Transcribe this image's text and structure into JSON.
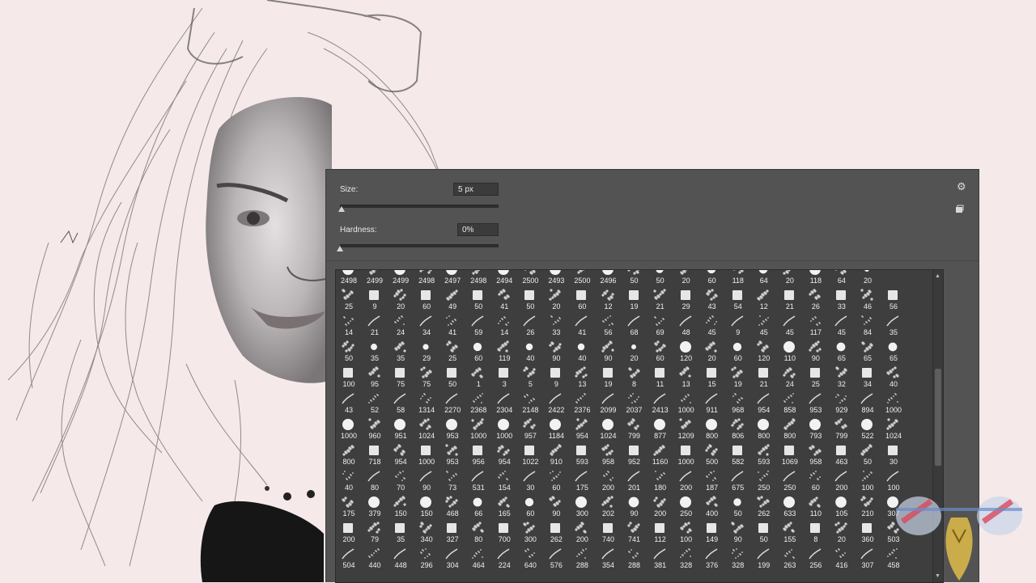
{
  "panel": {
    "size_label": "Size:",
    "size_value": "5 px",
    "size_level": 0.01,
    "hardness_label": "Hardness:",
    "hardness_value": "0%",
    "hardness_level": 0.0
  },
  "brush_grid": {
    "rows": [
      [
        "2498",
        "2499",
        "2499",
        "2498",
        "2497",
        "2498",
        "2494",
        "2500",
        "2493",
        "2500",
        "2496",
        "50",
        "50",
        "20",
        "60",
        "118",
        "64",
        "20",
        "118",
        "64",
        "20"
      ],
      [
        "25",
        "9",
        "20",
        "60",
        "49",
        "50",
        "41",
        "50",
        "20",
        "60",
        "12",
        "19",
        "21",
        "29",
        "43",
        "54",
        "12",
        "21",
        "26",
        "33",
        "46",
        "56"
      ],
      [
        "14",
        "21",
        "24",
        "34",
        "41",
        "59",
        "14",
        "26",
        "33",
        "41",
        "56",
        "68",
        "69",
        "48",
        "45",
        "9",
        "45",
        "45",
        "117",
        "45",
        "84",
        "35"
      ],
      [
        "50",
        "35",
        "35",
        "29",
        "25",
        "60",
        "119",
        "40",
        "90",
        "40",
        "90",
        "20",
        "60",
        "120",
        "20",
        "60",
        "120",
        "110",
        "90",
        "65",
        "65",
        "65"
      ],
      [
        "100",
        "95",
        "75",
        "75",
        "50",
        "1",
        "3",
        "5",
        "9",
        "13",
        "19",
        "8",
        "11",
        "13",
        "15",
        "19",
        "21",
        "24",
        "25",
        "32",
        "34",
        "40"
      ],
      [
        "43",
        "52",
        "58",
        "1314",
        "2270",
        "2368",
        "2304",
        "2148",
        "2422",
        "2376",
        "2099",
        "2037",
        "2413",
        "1000",
        "911",
        "968",
        "954",
        "858",
        "953",
        "929",
        "894",
        "1000"
      ],
      [
        "1000",
        "960",
        "951",
        "1024",
        "953",
        "1000",
        "1000",
        "957",
        "1184",
        "954",
        "1024",
        "799",
        "877",
        "1209",
        "800",
        "806",
        "800",
        "800",
        "793",
        "799",
        "522",
        "1024"
      ],
      [
        "800",
        "718",
        "954",
        "1000",
        "953",
        "956",
        "954",
        "1022",
        "910",
        "593",
        "958",
        "952",
        "1160",
        "1000",
        "500",
        "582",
        "593",
        "1069",
        "958",
        "463",
        "50",
        "30"
      ],
      [
        "40",
        "80",
        "70",
        "90",
        "73",
        "531",
        "154",
        "30",
        "60",
        "175",
        "200",
        "201",
        "180",
        "200",
        "187",
        "675",
        "250",
        "250",
        "60",
        "200",
        "100",
        "100"
      ],
      [
        "175",
        "379",
        "150",
        "150",
        "468",
        "66",
        "165",
        "60",
        "90",
        "300",
        "202",
        "90",
        "200",
        "250",
        "400",
        "50",
        "262",
        "633",
        "110",
        "105",
        "210",
        "307"
      ],
      [
        "200",
        "79",
        "35",
        "340",
        "327",
        "80",
        "700",
        "300",
        "262",
        "200",
        "740",
        "741",
        "112",
        "100",
        "149",
        "90",
        "50",
        "155",
        "8",
        "20",
        "360",
        "503"
      ],
      [
        "504",
        "440",
        "448",
        "296",
        "304",
        "464",
        "224",
        "640",
        "576",
        "288",
        "354",
        "288",
        "381",
        "328",
        "376",
        "328",
        "199",
        "263",
        "256",
        "416",
        "307",
        "458"
      ]
    ]
  }
}
